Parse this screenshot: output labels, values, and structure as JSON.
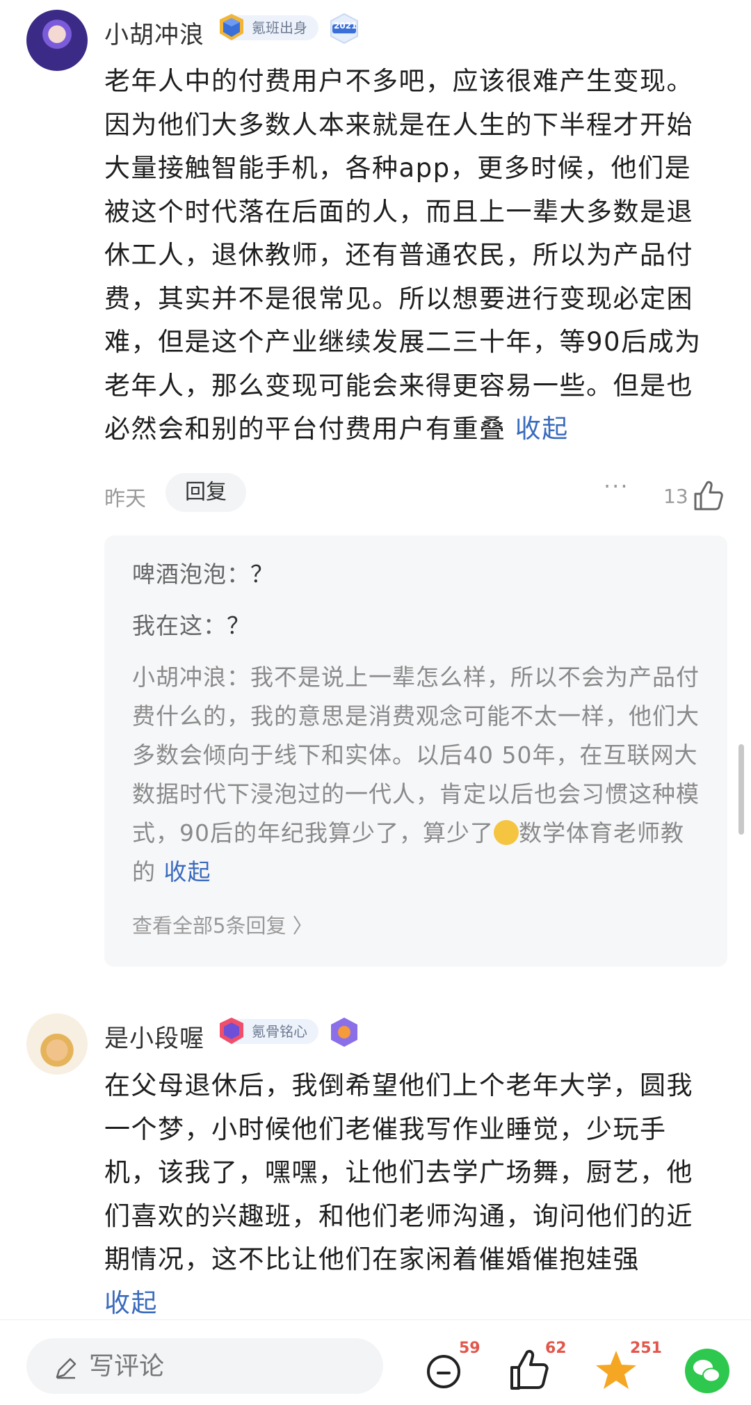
{
  "comments": [
    {
      "username": "小胡冲浪",
      "badge": "氪班出身",
      "year_badge": "2021",
      "text": "老年人中的付费用户不多吧，应该很难产生变现。因为他们大多数人本来就是在人生的下半程才开始大量接触智能手机，各种app，更多时候，他们是被这个时代落在后面的人，而且上一辈大多数是退休工人，退休教师，还有普通农民，所以为产品付费，其实并不是很常见。所以想要进行变现必定困难，但是这个产业继续发展二三十年，等90后成为老年人，那么变现可能会来得更容易一些。但是也必然会和别的平台付费用户有重叠",
      "collapse_label": "收起",
      "time": "昨天",
      "reply_label": "回复",
      "more_label": "···",
      "likes": "13",
      "replies": [
        {
          "author": "啤酒泡泡",
          "sep": "：",
          "text": "？"
        },
        {
          "author": "我在这",
          "sep": "：",
          "text": "？"
        },
        {
          "author": "小胡冲浪",
          "sep": "：",
          "text": "我不是说上一辈怎么样，所以不会为产品付费什么的，我的意思是消费观念可能不太一样，他们大多数会倾向于线下和实体。以后40 50年，在互联网大数据时代下浸泡过的一代人，肯定以后也会习惯这种模式，90后的年纪我算少了，算少了",
          "tail": "数学体育老师教的",
          "collapse_label": "收起"
        }
      ],
      "view_all_label": "查看全部5条回复 〉"
    },
    {
      "username": "是小段喔",
      "badge": "氪骨铭心",
      "text": "在父母退休后，我倒希望他们上个老年大学，圆我一个梦，小时候他们老催我写作业睡觉，少玩手机，该我了，嘿嘿，让他们去学广场舞，厨艺，他们喜欢的兴趣班，和他们老师沟通，询问他们的近期情况，这不比让他们在家闲着催婚催抱娃强",
      "collapse_label": "收起"
    }
  ],
  "bottom_bar": {
    "write_placeholder": "写评论",
    "comment_count": "59",
    "like_count": "62",
    "favorite_count": "251"
  },
  "colors": {
    "link_blue": "#3a6bbd",
    "count_red": "#e2574c",
    "star_orange": "#f5a623",
    "wechat_green": "#2dc84d"
  }
}
